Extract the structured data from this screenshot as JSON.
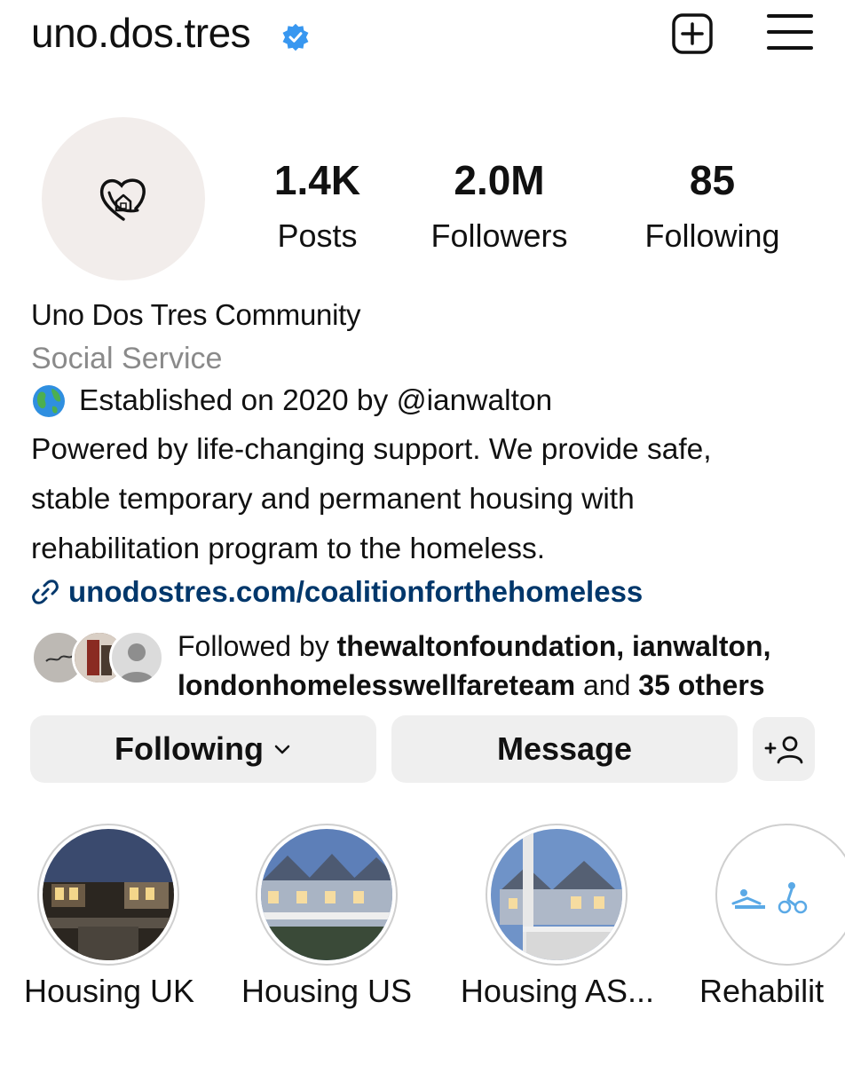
{
  "header": {
    "username": "uno.dos.tres",
    "verified_icon": "verified-badge-icon",
    "add_icon": "add-post-icon",
    "menu_icon": "hamburger-menu-icon"
  },
  "profile": {
    "avatar_icon": "heart-home-logo",
    "stats": {
      "posts_value": "1.4K",
      "posts_label": "Posts",
      "followers_value": "2.0M",
      "followers_label": "Followers",
      "following_value": "85",
      "following_label": "Following"
    },
    "display_name": "Uno Dos Tres Community",
    "category": "Social Service",
    "bio_line1": "Established on 2020 by @ianwalton",
    "bio_line2": "Powered by life-changing support. We provide safe,",
    "bio_line3": "stable temporary and permanent housing with",
    "bio_line4": "rehabilitation program to the homeless.",
    "link": "unodostres.com/coalitionforthehomeless"
  },
  "followed_by": {
    "prefix": "Followed by ",
    "user1": "thewaltonfoundation",
    "sep1": ", ",
    "user2": "ianwalton",
    "sep2": ",",
    "user3": "londonhomelesswellfareteam",
    "and": " and ",
    "others": "35 others"
  },
  "actions": {
    "following_label": "Following",
    "message_label": "Message",
    "add_user_icon": "add-person-icon"
  },
  "highlights": [
    {
      "label": "Housing UK"
    },
    {
      "label": "Housing US"
    },
    {
      "label": "Housing AS..."
    },
    {
      "label": "Rehabilit"
    }
  ],
  "colors": {
    "link": "#00376b",
    "verified": "#3897f0",
    "muted": "#8a8a8a",
    "button_bg": "#efefef"
  }
}
